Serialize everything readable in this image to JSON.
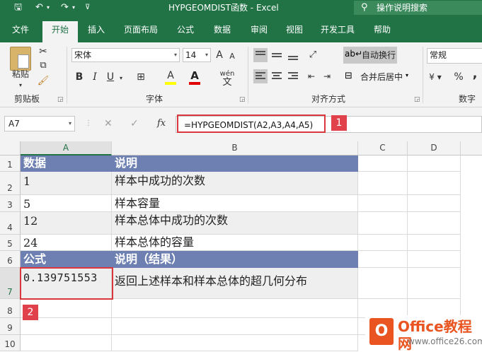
{
  "titlebar": {
    "title": "HYPGEOMDIST函数 - Excel",
    "tell_me": "操作说明搜索"
  },
  "ribbon_tabs": [
    "文件",
    "开始",
    "插入",
    "页面布局",
    "公式",
    "数据",
    "审阅",
    "视图",
    "开发工具",
    "帮助"
  ],
  "active_tab": "开始",
  "ribbon": {
    "clipboard": {
      "paste_label": "粘贴",
      "group_label": "剪贴板"
    },
    "font": {
      "name": "宋体",
      "size": "14",
      "group_label": "字体",
      "bold": "B",
      "italic": "I",
      "underline": "U",
      "grow": "A",
      "shrink": "A",
      "phonetic": "wén",
      "font_color_glyph": "A",
      "fill_glyph": "A"
    },
    "alignment": {
      "wrap_text": "自动换行",
      "merge_center": "合并后居中",
      "group_label": "对齐方式"
    },
    "number": {
      "format": "常规",
      "group_label": "数字",
      "percent": "%",
      "comma": ","
    }
  },
  "formula_bar": {
    "name_box": "A7",
    "cancel_glyph": "✕",
    "enter_glyph": "✓",
    "fx_glyph": "fx",
    "formula": "=HYPGEOMDIST(A2,A3,A4,A5)"
  },
  "markers": {
    "formula": "1",
    "cell": "2"
  },
  "columns": [
    "A",
    "B",
    "C",
    "D"
  ],
  "rows": [
    "1",
    "2",
    "3",
    "4",
    "5",
    "6",
    "7",
    "8",
    "9",
    "10"
  ],
  "cells": {
    "A1": "数据",
    "B1": "说明",
    "A2": "1",
    "B2": "样本中成功的次数",
    "A3": "5",
    "B3": "样本容量",
    "A4": "12",
    "B4": "样本总体中成功的次数",
    "A5": "24",
    "B5": "样本总体的容量",
    "A6": "公式",
    "B6": "说明（结果）",
    "A7": "0.139751553",
    "B7": "返回上述样本和样本总体的超几何分布"
  },
  "watermark": {
    "logo": "O",
    "brand": "Office教程网",
    "url": "www.office26.com"
  },
  "colors": {
    "excel_green": "#217346",
    "table_header": "#6e80b2",
    "highlight": "#d9373c",
    "watermark": "#e95420"
  }
}
